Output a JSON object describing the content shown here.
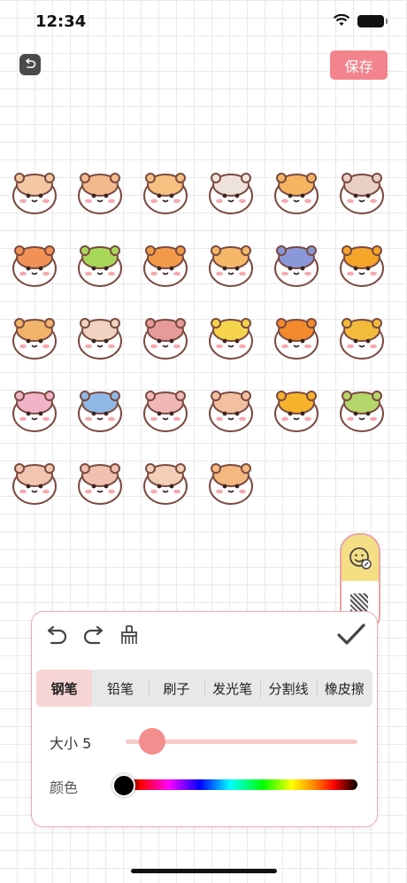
{
  "status_bar": {
    "time": "12:34"
  },
  "header": {
    "back_icon": "undo-arrow-icon",
    "save_label": "保存"
  },
  "stickers": [
    {
      "name": "hamster-sticker",
      "color": "#f3c8a3"
    },
    {
      "name": "hamster-sticker",
      "color": "#f2b98d"
    },
    {
      "name": "hamster-sticker",
      "color": "#f5c080"
    },
    {
      "name": "hamster-sticker",
      "color": "#eee2dc"
    },
    {
      "name": "cat-sticker",
      "color": "#f5b560"
    },
    {
      "name": "cat-sticker",
      "color": "#e9cfc4"
    },
    {
      "name": "hamster-sticker",
      "color": "#f29155"
    },
    {
      "name": "cup-sticker",
      "color": "#a7d85a"
    },
    {
      "name": "hamster-sticker",
      "color": "#f29a4a"
    },
    {
      "name": "hamster-sticker",
      "color": "#f5b86a"
    },
    {
      "name": "hamster-sticker",
      "color": "#8a97d8"
    },
    {
      "name": "bear-sticker",
      "color": "#f4a52a"
    },
    {
      "name": "hamster-sticker",
      "color": "#f2b36a"
    },
    {
      "name": "hamster-sticker",
      "color": "#f1d2c0"
    },
    {
      "name": "hamster-sticker",
      "color": "#e69a9a"
    },
    {
      "name": "melon-sticker",
      "color": "#f5d44c"
    },
    {
      "name": "chick-sticker",
      "color": "#f38a2e"
    },
    {
      "name": "dog-sticker",
      "color": "#f2bc3a"
    },
    {
      "name": "bath-sticker",
      "color": "#f2b2c8"
    },
    {
      "name": "hamster-sticker",
      "color": "#8fb8e6"
    },
    {
      "name": "hamster-sticker",
      "color": "#f0b7b7"
    },
    {
      "name": "hamster-sticker",
      "color": "#f2c0a0"
    },
    {
      "name": "fox-sticker",
      "color": "#f7b22c"
    },
    {
      "name": "frog-sticker",
      "color": "#b4d66a"
    },
    {
      "name": "hamster-sticker",
      "color": "#f2c5b0"
    },
    {
      "name": "hamster-sticker",
      "color": "#f0c0b0"
    },
    {
      "name": "hamster-sticker",
      "color": "#f3cfb7"
    },
    {
      "name": "hamster-sticker",
      "color": "#f5b880"
    }
  ],
  "panel": {
    "tabs": [
      "钢笔",
      "铅笔",
      "刷子",
      "发光笔",
      "分割线",
      "橡皮擦"
    ],
    "active_tab": "钢笔",
    "size_label": "大小 5",
    "size_value": 5,
    "color_label": "颜色",
    "selected_color": "#000000"
  },
  "colors": {
    "accent": "#f3848e",
    "active_tab_bg": "#f7d5d4",
    "slider_thumb": "#f28e8d"
  }
}
